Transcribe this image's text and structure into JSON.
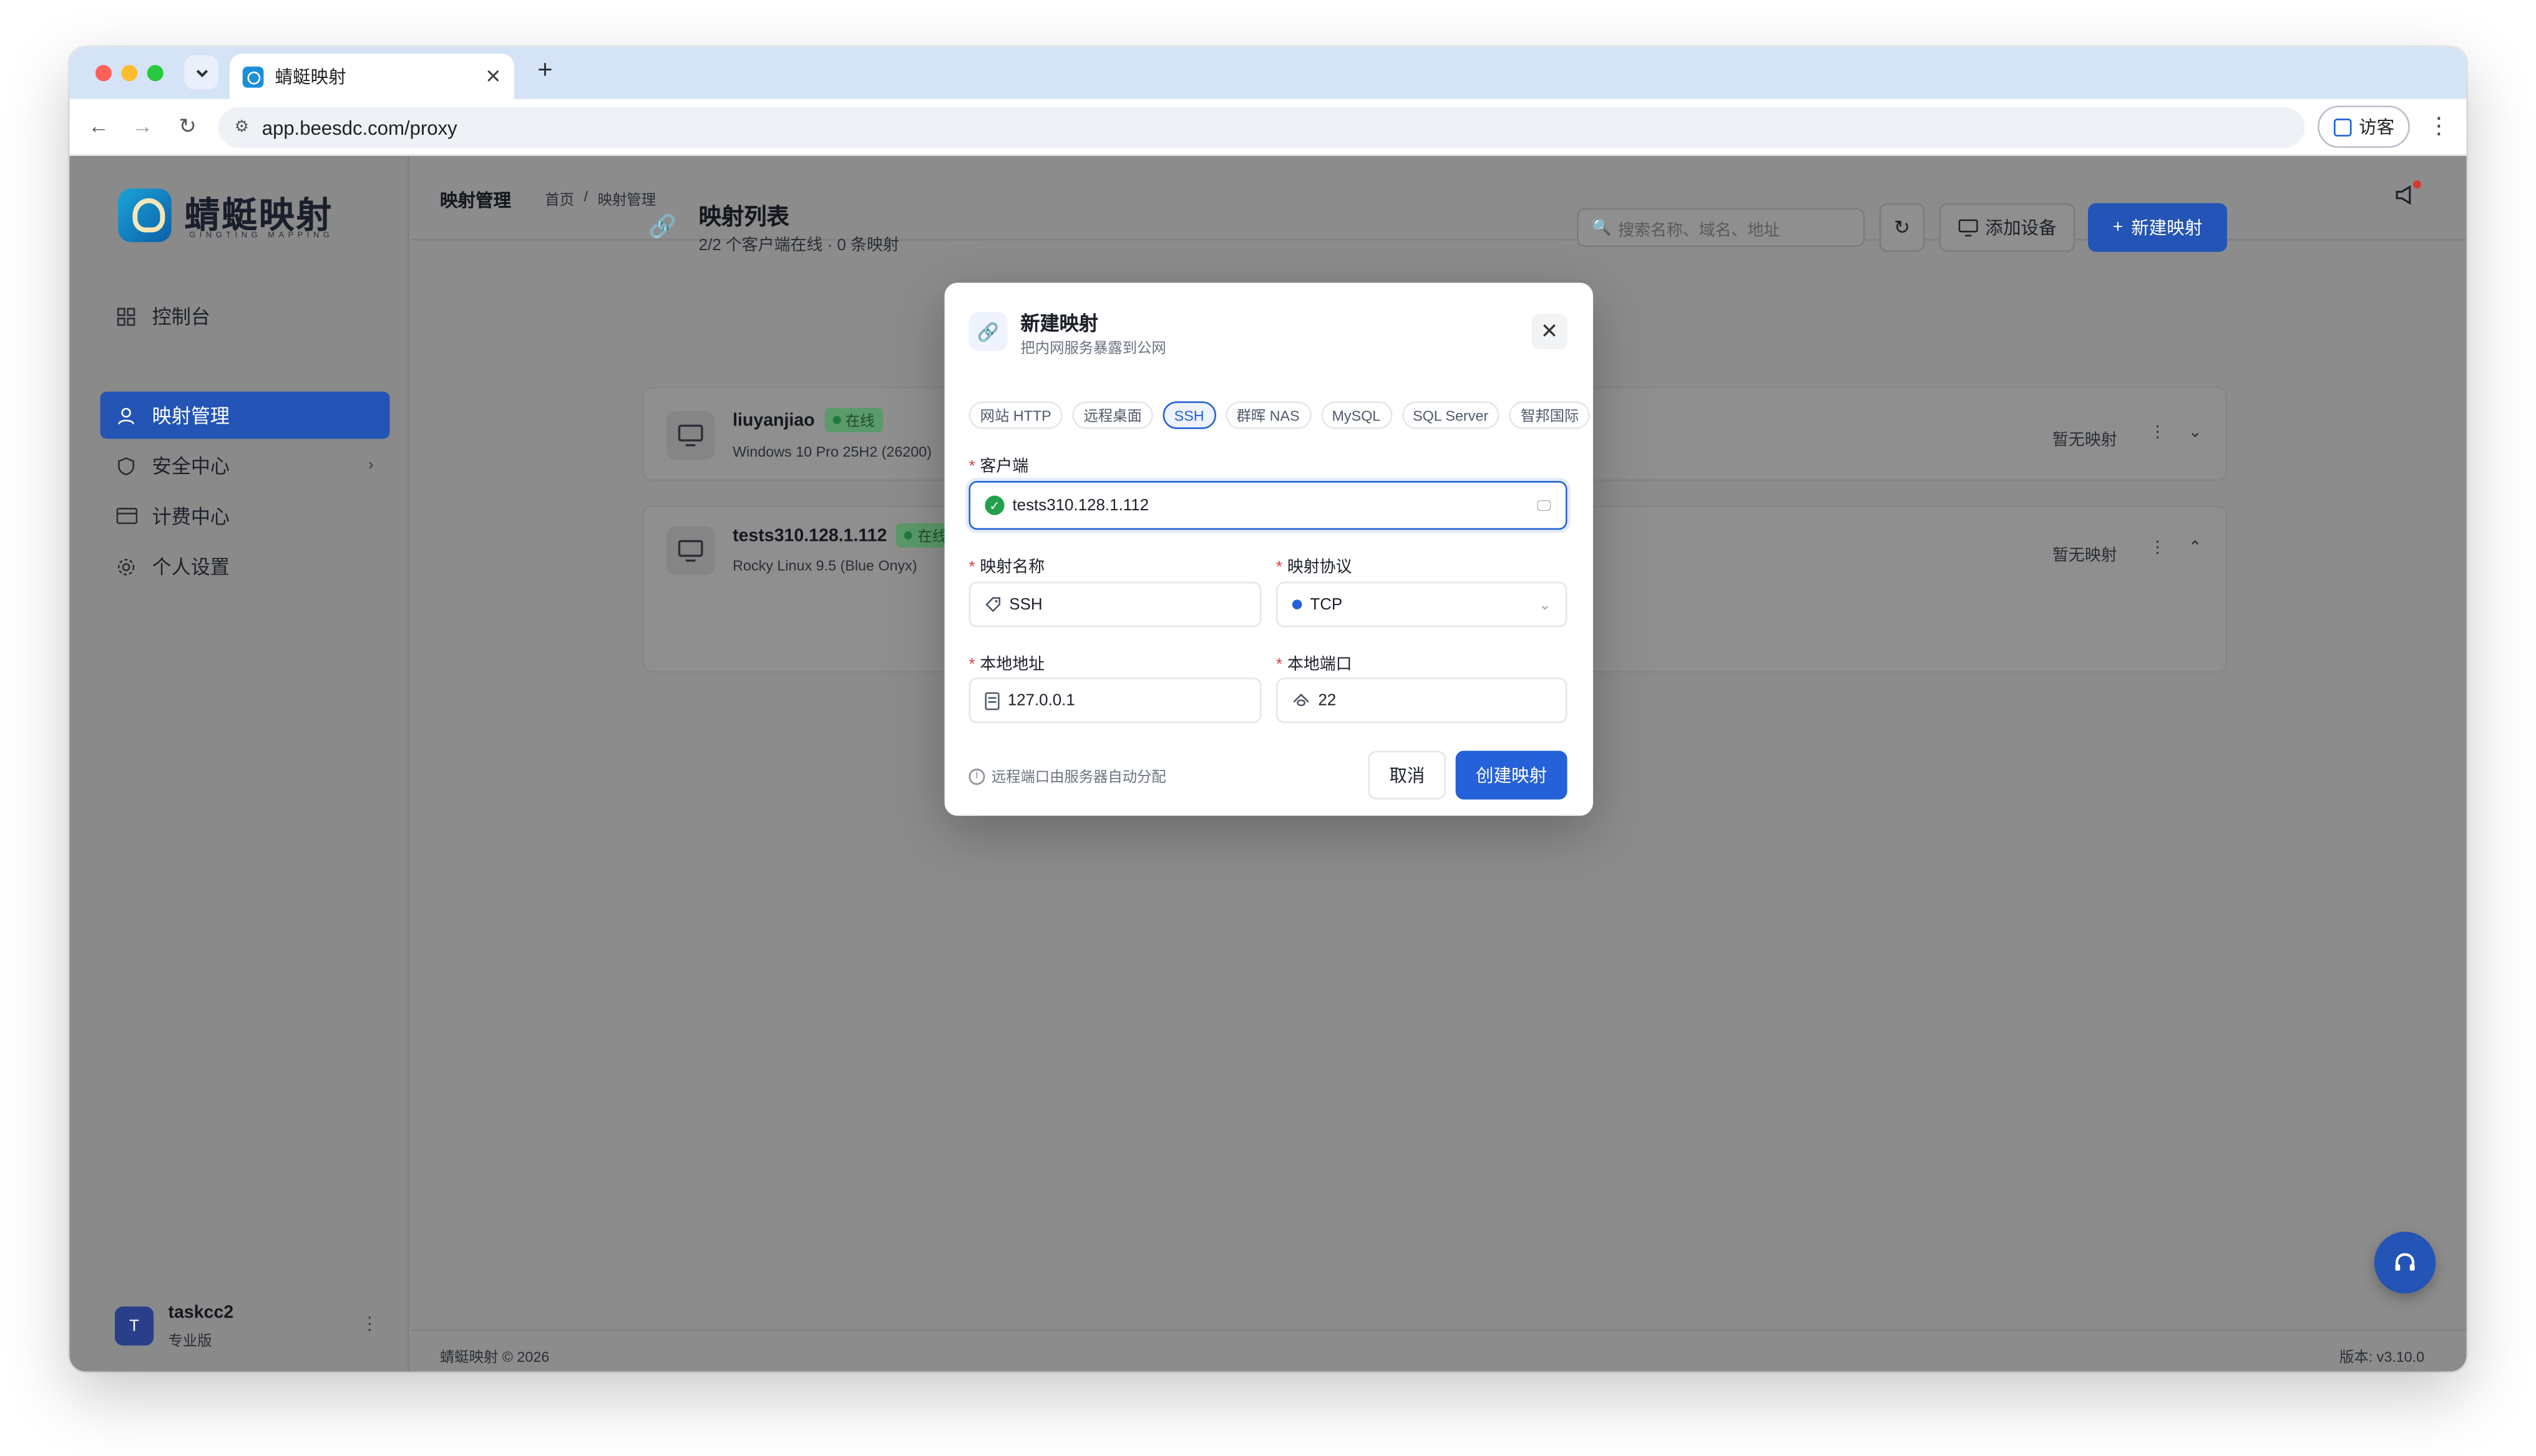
{
  "browser": {
    "tab_title": "蜻蜓映射",
    "url": "app.beesdc.com/proxy",
    "guest_label": "访客"
  },
  "brand": {
    "name": "蜻蜓映射",
    "tagline": "GINGTING MAPPING"
  },
  "sidebar": {
    "items": [
      {
        "label": "控制台",
        "icon": "grid-icon",
        "active": false
      },
      {
        "label": "映射管理",
        "icon": "user-icon",
        "active": true
      },
      {
        "label": "安全中心",
        "icon": "shield-icon",
        "active": false,
        "has_submenu": true
      },
      {
        "label": "计费中心",
        "icon": "card-icon",
        "active": false
      },
      {
        "label": "个人设置",
        "icon": "gear-icon",
        "active": false
      }
    ],
    "user": {
      "initial": "T",
      "name": "taskcc2",
      "plan": "专业版"
    }
  },
  "header": {
    "title": "映射管理",
    "breadcrumb": [
      "首页",
      "/",
      "映射管理"
    ]
  },
  "list": {
    "title": "映射列表",
    "subtitle": "2/2 个客户端在线 · 0 条映射",
    "search_placeholder": "搜索名称、域名、地址",
    "add_device_label": "添加设备",
    "new_mapping_label": "新建映射",
    "clients": [
      {
        "name": "liuyanjiao",
        "status": "在线",
        "os": "Windows 10 Pro 25H2 (26200)",
        "mapping_text": "暂无映射",
        "expanded": false
      },
      {
        "name": "tests310.128.1.112",
        "status": "在线",
        "os": "Rocky Linux 9.5 (Blue Onyx)",
        "mapping_text": "暂无映射",
        "expanded": true
      }
    ]
  },
  "footer": {
    "copyright": "蜻蜓映射 © 2026",
    "version": "版本: v3.10.0"
  },
  "modal": {
    "title": "新建映射",
    "subtitle": "把内网服务暴露到公网",
    "presets": [
      {
        "label": "网站 HTTP",
        "active": false
      },
      {
        "label": "远程桌面",
        "active": false
      },
      {
        "label": "SSH",
        "active": true
      },
      {
        "label": "群晖 NAS",
        "active": false
      },
      {
        "label": "MySQL",
        "active": false
      },
      {
        "label": "SQL Server",
        "active": false
      },
      {
        "label": "智邦国际",
        "active": false
      }
    ],
    "required_mark": "*",
    "client_label": "客户端",
    "client_value": "tests310.128.1.112",
    "name_label": "映射名称",
    "name_value": "SSH",
    "protocol_label": "映射协议",
    "protocol_value": "TCP",
    "local_addr_label": "本地地址",
    "local_addr_value": "127.0.0.1",
    "local_port_label": "本地端口",
    "local_port_value": "22",
    "hint": "远程端口由服务器自动分配",
    "cancel_label": "取消",
    "create_label": "创建映射"
  },
  "colors": {
    "primary": "#2561d8",
    "sidebar_active": "#2354b6",
    "online": "#23a04c",
    "required": "#e0393e",
    "overlay": "#8c8c8c"
  }
}
